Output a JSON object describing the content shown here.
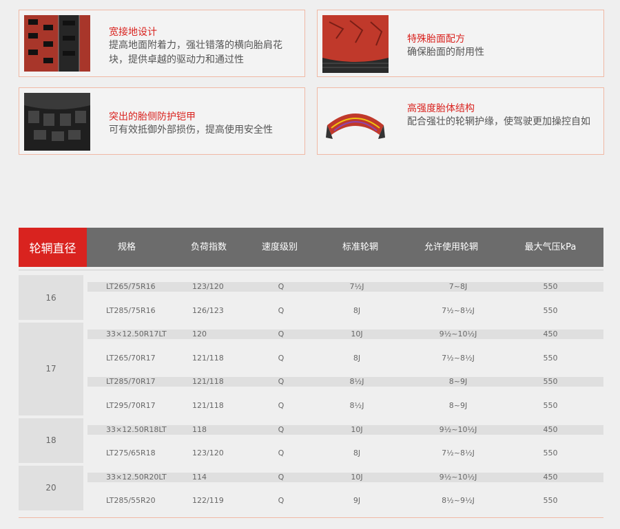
{
  "features": [
    {
      "title": "宽接地设计",
      "desc": "提高地面附着力，强壮错落的横向胎肩花块，提供卓越的驱动力和通过性",
      "icon": "tread-pattern-icon"
    },
    {
      "title": "特殊胎面配方",
      "desc": "确保胎面的耐用性",
      "icon": "tread-compound-icon"
    },
    {
      "title": "突出的胎侧防护铠甲",
      "desc": "可有效抵御外部损伤，提高使用安全性",
      "icon": "sidewall-armor-icon"
    },
    {
      "title": "高强度胎体结构",
      "desc": "配合强壮的轮辋护缘，使驾驶更加操控自如",
      "icon": "tire-casing-icon"
    }
  ],
  "table": {
    "rim_header": "轮辋直径",
    "headers": [
      "规格",
      "负荷指数",
      "速度级别",
      "标准轮辋",
      "允许使用轮辋",
      "最大气压kPa"
    ],
    "groups": [
      {
        "rim": "16",
        "rows": [
          [
            "LT265/75R16",
            "123/120",
            "Q",
            "7½J",
            "7~8J",
            "550"
          ],
          [
            "LT285/75R16",
            "126/123",
            "Q",
            "8J",
            "7½~8½J",
            "550"
          ]
        ]
      },
      {
        "rim": "17",
        "rows": [
          [
            "33×12.50R17LT",
            "120",
            "Q",
            "10J",
            "9½~10½J",
            "450"
          ],
          [
            "LT265/70R17",
            "121/118",
            "Q",
            "8J",
            "7½~8½J",
            "550"
          ],
          [
            "LT285/70R17",
            "121/118",
            "Q",
            "8½J",
            "8~9J",
            "550"
          ],
          [
            "LT295/70R17",
            "121/118",
            "Q",
            "8½J",
            "8~9J",
            "550"
          ]
        ]
      },
      {
        "rim": "18",
        "rows": [
          [
            "33×12.50R18LT",
            "118",
            "Q",
            "10J",
            "9½~10½J",
            "450"
          ],
          [
            "LT275/65R18",
            "123/120",
            "Q",
            "8J",
            "7½~8½J",
            "550"
          ]
        ]
      },
      {
        "rim": "20",
        "rows": [
          [
            "33×12.50R20LT",
            "114",
            "Q",
            "10J",
            "9½~10½J",
            "450"
          ],
          [
            "LT285/55R20",
            "122/119",
            "Q",
            "9J",
            "8½~9½J",
            "550"
          ]
        ]
      }
    ]
  },
  "colors": {
    "accent": "#d9231f",
    "header_bg": "#6c6c6c",
    "card_border": "#f0b8a4"
  }
}
